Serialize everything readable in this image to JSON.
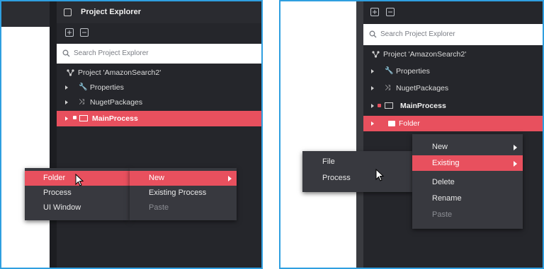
{
  "left": {
    "panel_title": "Project Explorer",
    "search_placeholder": "Search Project Explorer",
    "tree": {
      "project": "Project  'AmazonSearch2'",
      "properties": "Properties",
      "nuget": "NugetPackages",
      "main": "MainProcess"
    },
    "menu1": {
      "items": [
        "Folder",
        "Process",
        "UI Window"
      ]
    },
    "menu2": {
      "items": [
        "New",
        "Existing Process",
        "Paste"
      ]
    }
  },
  "right": {
    "search_placeholder": "Search Project Explorer",
    "tree": {
      "project": "Project  'AmazonSearch2'",
      "properties": "Properties",
      "nuget": "NugetPackages",
      "main": "MainProcess",
      "folder": "Folder"
    },
    "menu_new": {
      "items": [
        "File",
        "Process"
      ]
    },
    "menu_ctx": {
      "items": [
        "New",
        "Existing",
        "Delete",
        "Rename",
        "Paste"
      ]
    }
  },
  "colors": {
    "accent": "#e8505e",
    "panel_bg": "#25262b",
    "menu_bg": "#38393f",
    "frame": "#2f9fe0"
  }
}
